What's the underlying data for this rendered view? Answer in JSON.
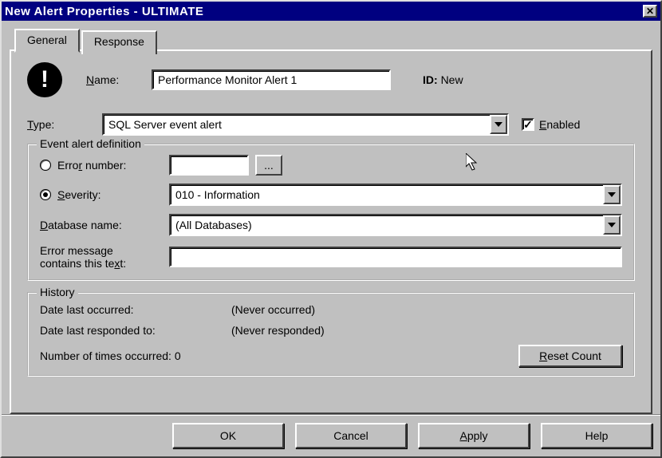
{
  "window": {
    "title": "New Alert Properties - ULTIMATE"
  },
  "tabs": {
    "general": "General",
    "response": "Response"
  },
  "header": {
    "name_label_pre": "N",
    "name_label_post": "ame:",
    "name_value": "Performance Monitor Alert 1",
    "id_label": "ID:",
    "id_value": "New"
  },
  "type": {
    "label_pre": "T",
    "label_post": "ype:",
    "value": "SQL Server event alert",
    "enabled_pre": "E",
    "enabled_post": "nabled"
  },
  "eventdef": {
    "legend": "Event alert definition",
    "errnum_label_pre": "E",
    "errnum_label_mid": "rro",
    "errnum_label_under2": "r",
    "errnum_label_post": " number:",
    "errnum_value": "",
    "browse": "...",
    "severity_pre": "S",
    "severity_post": "everity:",
    "severity_value": "010 - Information",
    "dbname_pre": "D",
    "dbname_post": "atabase name:",
    "dbname_value": "(All Databases)",
    "msgtext_line1": "Error message",
    "msgtext_line2_pre": "contains this te",
    "msgtext_under": "x",
    "msgtext_line2_post": "t:",
    "msgtext_value": ""
  },
  "history": {
    "legend": "History",
    "last_occurred_label": "Date last occurred:",
    "last_occurred_value": "(Never occurred)",
    "last_responded_label": "Date last responded to:",
    "last_responded_value": "(Never responded)",
    "count_label": "Number of times occurred:",
    "count_value": "0",
    "reset_pre": "R",
    "reset_post": "eset Count"
  },
  "buttons": {
    "ok": "OK",
    "cancel": "Cancel",
    "apply_pre": "A",
    "apply_post": "pply",
    "help": "Help"
  }
}
